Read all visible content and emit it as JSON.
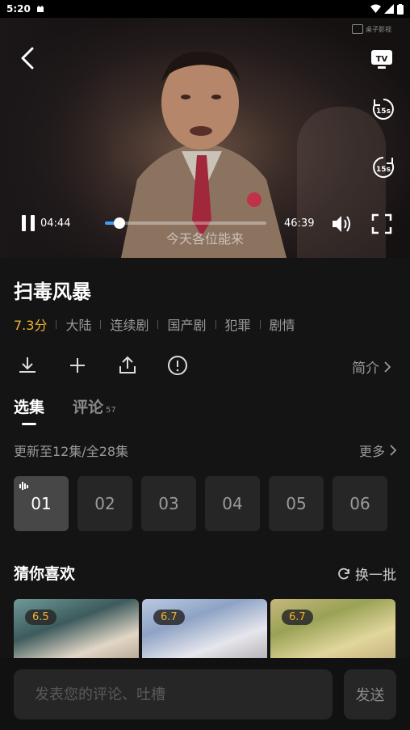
{
  "status_bar": {
    "time": "5:20"
  },
  "player": {
    "watermark": "桌子影视",
    "current_time": "04:44",
    "duration": "46:39",
    "progress": 0.09,
    "subtitle": "今天各位能来",
    "rewind_label": "15s",
    "forward_label": "15s",
    "tv_label": "TV"
  },
  "show": {
    "title": "扫毒风暴",
    "score": "7.3分",
    "tags": [
      "大陆",
      "连续剧",
      "国产剧",
      "犯罪",
      "剧情"
    ],
    "intro_label": "简介"
  },
  "tabs": {
    "episodes_label": "选集",
    "comments_label": "评论",
    "comments_count": "57"
  },
  "episodes": {
    "update_text": "更新至12集/全28集",
    "more_label": "更多",
    "items": [
      "01",
      "02",
      "03",
      "04",
      "05",
      "06"
    ]
  },
  "recommend": {
    "title": "猜你喜欢",
    "refresh_label": "换一批",
    "ratings": [
      "6.5",
      "6.7",
      "6.7"
    ]
  },
  "comment": {
    "placeholder": "发表您的评论、吐槽",
    "send_label": "发送"
  },
  "colors": {
    "accent": "#3aa0ff",
    "score": "#f2b232",
    "background": "#141414"
  }
}
